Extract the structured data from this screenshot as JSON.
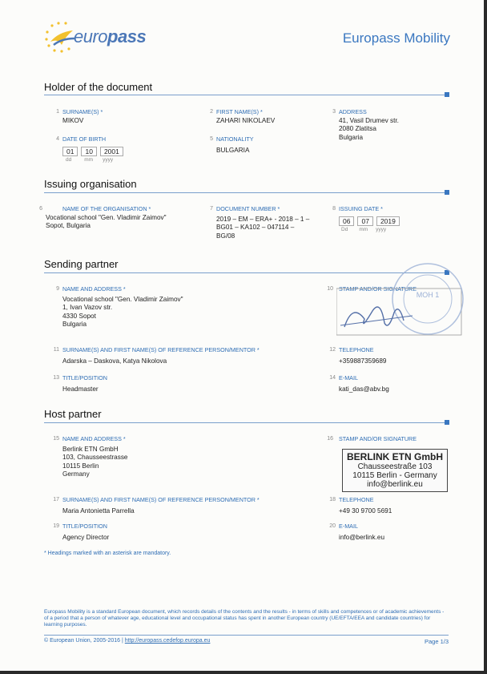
{
  "header": {
    "logo_text_a": "euro",
    "logo_text_b": "pass",
    "doc_title": "Europass Mobility"
  },
  "holder": {
    "title": "Holder of the document",
    "surname": {
      "num": "1",
      "label": "SURNAME(S) *",
      "value": "MIKOV"
    },
    "first_name": {
      "num": "2",
      "label": "FIRST NAME(S) *",
      "value": "ZAHARI NIKOLAEV"
    },
    "address": {
      "num": "3",
      "label": "ADDRESS",
      "value": "41, Vasil Drumev str.\n2080 Zlatitsa\nBulgaria"
    },
    "dob": {
      "num": "4",
      "label": "DATE OF BIRTH",
      "dd": "01",
      "mm": "10",
      "yyyy": "2001",
      "cap_dd": "dd",
      "cap_mm": "mm",
      "cap_yyyy": "yyyy"
    },
    "nationality": {
      "num": "5",
      "label": "NATIONALITY",
      "value": "BULGARIA"
    }
  },
  "issuing": {
    "title": "Issuing organisation",
    "org": {
      "num": "6",
      "label": "NAME OF THE ORGANISATION *",
      "value": "Vocational school \"Gen. Vladimir Zaimov\"\nSopot, Bulgaria"
    },
    "docnum": {
      "num": "7",
      "label": "DOCUMENT NUMBER *",
      "value": "2019 – EM – ERA+ - 2018 – 1 –\nBG01 – KA102 – 047114 –\nBG/08"
    },
    "issue_date": {
      "num": "8",
      "label": "ISSUING DATE *",
      "dd": "06",
      "mm": "07",
      "yyyy": "2019",
      "cap_dd": "Dd",
      "cap_mm": "mm",
      "cap_yyyy": "yyyy"
    }
  },
  "sending": {
    "title": "Sending partner",
    "name": {
      "num": "9",
      "label": "NAME AND ADDRESS *",
      "value": "Vocational school \"Gen. Vladimir Zaimov\"\n1, Ivan Vazov str.\n4330 Sopot\nBulgaria"
    },
    "stamp": {
      "num": "10",
      "label": "STAMP AND/OR SIGNATURE",
      "center": "МОН\n1"
    },
    "mentor": {
      "num": "11",
      "label": "SURNAME(S) AND FIRST NAME(S) OF REFERENCE PERSON/MENTOR *",
      "value": "Adarska – Daskova, Katya Nikolova"
    },
    "phone": {
      "num": "12",
      "label": "TELEPHONE",
      "value": "+359887359689"
    },
    "position": {
      "num": "13",
      "label": "TITLE/POSITION",
      "value": "Headmaster"
    },
    "email": {
      "num": "14",
      "label": "E-MAIL",
      "value": "kati_das@abv.bg"
    }
  },
  "host": {
    "title": "Host partner",
    "name": {
      "num": "15",
      "label": "NAME AND ADDRESS *",
      "value": "Berlink ETN GmbH\n103, Chausseestrasse\n10115 Berlin\nGermany"
    },
    "stamp": {
      "num": "16",
      "label": "STAMP AND/OR SIGNATURE",
      "title": "BERLINK ETN GmbH",
      "line1": "Chausseestraße 103",
      "line2": "10115 Berlin - Germany",
      "line3": "info@berlink.eu"
    },
    "mentor": {
      "num": "17",
      "label": "SURNAME(S) AND FIRST NAME(S) OF REFERENCE PERSON/MENTOR *",
      "value": "Maria Antonietta Parrella"
    },
    "phone": {
      "num": "18",
      "label": "TELEPHONE",
      "value": "+49 30 9700 5691"
    },
    "position": {
      "num": "19",
      "label": "TITLE/POSITION",
      "value": "Agency Director"
    },
    "email": {
      "num": "20",
      "label": "E-MAIL",
      "value": "info@berlink.eu"
    }
  },
  "footnote": "* Headings marked with an asterisk are mandatory.",
  "footer": {
    "description": "Europass Mobility is a standard European document, which records details of the contents and the results - in terms of skills and competences or of academic achievements - of a period that a person of whatever age, educational level and occupational status has spent in another European country (UE/EFTA/EEA and candidate countries) for learning purposes.",
    "copyright": "© European Union, 2005-2016 | ",
    "link": "http://europass.cedefop.europa.eu",
    "page": "Page 1/3"
  },
  "colors": {
    "accent": "#3a77c0",
    "label": "#2e6db4",
    "rule": "#7a9fcc"
  }
}
